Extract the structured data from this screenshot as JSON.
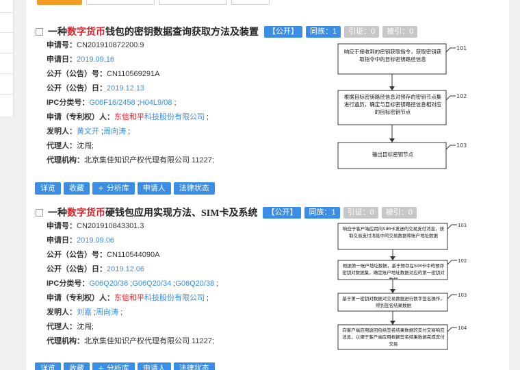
{
  "records": [
    {
      "title_prefix": "一种",
      "title_highlight": "数字货币",
      "title_suffix": "钱包的密钥数据查询获取方法及装置",
      "status_badge": "【公开】",
      "family_badge": "同族：1",
      "cite_badge": "引证：0",
      "cited_badge": "被引：0",
      "fields": {
        "app_no_label": "申请号：",
        "app_no": "CN201910872200.9",
        "app_date_label": "申请日：",
        "app_date": "2019.09.16",
        "pub_no_label": "公开（公告）号：",
        "pub_no": "CN110569291A",
        "pub_date_label": "公开（公告）日：",
        "pub_date": "2019.12.13",
        "ipc_label": "IPC分类号：",
        "ipc_1": "G06F16/2458",
        "ipc_sep": " ;",
        "ipc_2": "H04L9/08",
        "ipc_end": " ;",
        "applicant_label": "申请（专利权）人：",
        "applicant_hl": "东信和平",
        "applicant_rest": "科技股份有限公司",
        "applicant_end": " ;",
        "inventor_label": "发明人：",
        "inventor_1": "黄文开",
        "inventor_sep": " ;",
        "inventor_2": "周向涛",
        "inventor_end": " ;",
        "agent_label": "代理人：",
        "agent": "沈闯;",
        "agency_label": "代理机构：",
        "agency": "北京集佳知识产权代理有限公司 11227;"
      },
      "figure": {
        "boxes": [
          "响应于接收到的密钥获取指令，获取密钥获取指令中的目标密钥路径信息",
          "根据目标密钥路径信息对预存的密钥节点集进行遍历，确定与目标密钥路径信息相对应的目标密钥节点",
          "输出目标密钥节点"
        ],
        "labels": [
          "101",
          "102",
          "103"
        ]
      },
      "actions": [
        "详览",
        "收藏",
        "+ 分析库",
        "申请人",
        "法律状态"
      ]
    },
    {
      "title_prefix": "一种",
      "title_highlight": "数字货币",
      "title_suffix": "硬钱包应用实现方法、SIM卡及系统",
      "status_badge": "【公开】",
      "family_badge": "同族：1",
      "cite_badge": "引证：0",
      "cited_badge": "被引：0",
      "fields": {
        "app_no_label": "申请号：",
        "app_no": "CN201910843301.3",
        "app_date_label": "申请日：",
        "app_date": "2019.09.06",
        "pub_no_label": "公开（公告）号：",
        "pub_no": "CN110544090A",
        "pub_date_label": "公开（公告）日：",
        "pub_date": "2019.12.06",
        "ipc_label": "IPC分类号：",
        "ipc_1": "G06Q20/36",
        "ipc_sep": " ;",
        "ipc_2": "G06Q20/34",
        "ipc_sep2": " ;",
        "ipc_3": "G06Q20/38",
        "ipc_end": " ;",
        "applicant_label": "申请（专利权）人：",
        "applicant_hl": "东信和平",
        "applicant_rest": "科技股份有限公司",
        "applicant_end": " ;",
        "inventor_label": "发明人：",
        "inventor_1": "刘嘉",
        "inventor_sep": " ;",
        "inventor_2": "周向涛",
        "inventor_end": " ;",
        "agent_label": "代理人：",
        "agent": "沈闯;",
        "agency_label": "代理机构：",
        "agency": "北京集佳知识产权代理有限公司 11227;"
      },
      "figure": {
        "boxes": [
          "响应于客户端应用向SIM卡发送的交易支付消息，获取交易支付消息中的交易数据和账户地址数据",
          "根据第一账户地址数据，基于预存在SIM卡中的预存密钥对数据集，确定账户地址数据对应的第一密钥对数据",
          "基于第一密钥对数据对交易数据进行数字签名操作，得到签名结果数据",
          "向客户端应用返回包括签名结果数据的支付交易响应消息，以便于客户端应用根据签名结果数据完成支付交易"
        ],
        "labels": [
          "101",
          "102",
          "103",
          "104"
        ]
      },
      "actions": [
        "详览",
        "收藏",
        "+ 分析库",
        "申请人",
        "法律状态"
      ]
    }
  ]
}
